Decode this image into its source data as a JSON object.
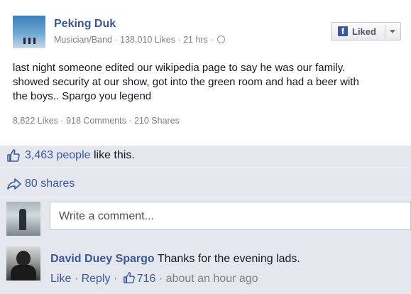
{
  "post": {
    "page_name": "Peking Duk",
    "category": "Musician/Band",
    "page_likes": "138,010 Likes",
    "time": "21 hrs",
    "liked_button_label": "Liked",
    "text_lines": [
      "last night someone edited our wikipedia page to say he was our family.",
      "showed security at our show, got into the green room and had a beer with",
      "the boys.. Spargo you legend"
    ],
    "stats": {
      "likes": "8,822 Likes",
      "comments": "918 Comments",
      "shares": "210 Shares"
    }
  },
  "ufi": {
    "like_count": "3,463 people",
    "like_suffix": " like this.",
    "shares": "80 shares",
    "comment_placeholder": "Write a comment..."
  },
  "comment": {
    "author": "David Duey Spargo",
    "text": " Thanks for the evening lads.",
    "like_label": "Like",
    "reply_label": "Reply",
    "like_count": "716",
    "time": "about an hour ago"
  },
  "colors": {
    "link": "#3b5998",
    "ufi_background": "#e4e7ee",
    "secondary_text": "#7a7f88"
  }
}
